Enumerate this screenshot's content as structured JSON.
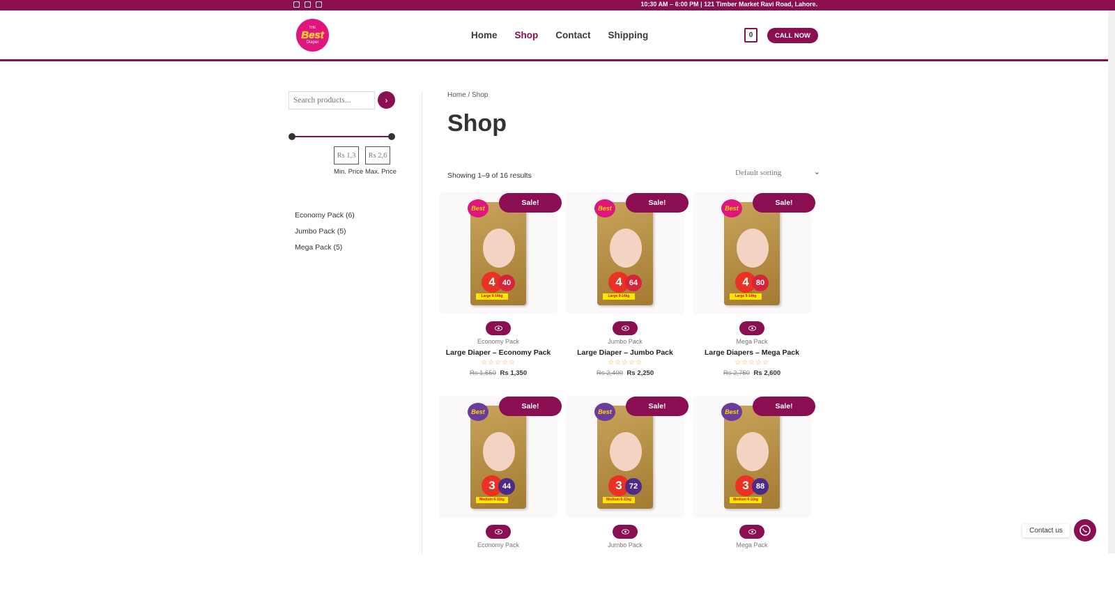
{
  "topbar": {
    "info": "10:30 AM – 6:00 PM | 121 Timber Market Ravi Road, Lahore.",
    "socials": [
      "facebook-icon",
      "instagram-icon",
      "tiktok-icon"
    ]
  },
  "header": {
    "logo": {
      "t1": "THE",
      "t2": "Best",
      "t3": "Diaper"
    },
    "nav": [
      {
        "label": "Home",
        "active": false
      },
      {
        "label": "Shop",
        "active": true
      },
      {
        "label": "Contact",
        "active": false
      },
      {
        "label": "Shipping",
        "active": false
      }
    ],
    "cart_count": "0",
    "call_label": "CALL NOW"
  },
  "sidebar": {
    "search_placeholder": "Search products...",
    "price_min": "Rs 1,3",
    "price_max": "Rs 2,6",
    "min_label": "Min. Price",
    "max_label": "Max. Price",
    "categories": [
      "Economy Pack (6)",
      "Jumbo Pack (5)",
      "Mega Pack (5)"
    ]
  },
  "main": {
    "breadcrumb": "Home / Shop",
    "title": "Shop",
    "result_count": "Showing 1–9 of 16 results",
    "sorting": "Default sorting",
    "sale_label": "Sale!",
    "stars": "☆☆☆☆☆",
    "products": [
      {
        "category": "Economy Pack",
        "name": "Large Diaper – Economy Pack",
        "old_price": "Rs 1,650",
        "new_price": "Rs 1,350",
        "size": "4",
        "qty": "40",
        "weight": "Large 9-14kg",
        "theme": "gold"
      },
      {
        "category": "Jumbo Pack",
        "name": "Large Diaper – Jumbo Pack",
        "old_price": "Rs 2,400",
        "new_price": "Rs 2,250",
        "size": "4",
        "qty": "64",
        "weight": "Large 9-14kg",
        "theme": "gold"
      },
      {
        "category": "Mega Pack",
        "name": "Large Diapers – Mega Pack",
        "old_price": "Rs 2,750",
        "new_price": "Rs 2,600",
        "size": "4",
        "qty": "80",
        "weight": "Large 9-14kg",
        "theme": "gold"
      },
      {
        "category": "Economy Pack",
        "name": "",
        "old_price": "",
        "new_price": "",
        "size": "3",
        "qty": "44",
        "weight": "Medium 6-11kg",
        "theme": "purple"
      },
      {
        "category": "Jumbo Pack",
        "name": "",
        "old_price": "",
        "new_price": "",
        "size": "3",
        "qty": "72",
        "weight": "Medium 6-11kg",
        "theme": "purple"
      },
      {
        "category": "Mega Pack",
        "name": "",
        "old_price": "",
        "new_price": "",
        "size": "3",
        "qty": "88",
        "weight": "Medium 6-11kg",
        "theme": "purple"
      }
    ]
  },
  "contact": {
    "label": "Contact us"
  },
  "colors": {
    "brand": "#8b0d52",
    "logo_pink": "#e0157d",
    "star": "#f3a33c"
  }
}
